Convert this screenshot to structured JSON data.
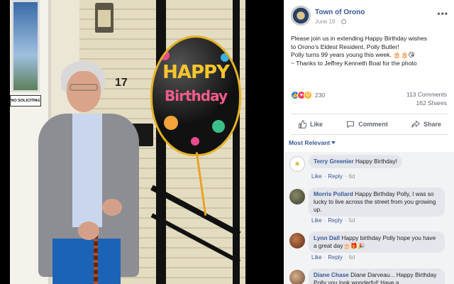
{
  "post": {
    "page_name": "Town of Orono",
    "date": "June 19",
    "dot": "·",
    "more": "•••",
    "text_lines": [
      "Please join us in extending Happy Birthday wishes",
      "to Orono's Eldest Resident, Polly Butler!",
      "Polly turns 99 years young this week. 🎂🎂😘",
      "~ Thanks to Jeffrey Kenneth Boal for the photo"
    ]
  },
  "photo": {
    "sign": "NO SOLICITING",
    "house_number": "17",
    "balloon_line1": "HAPPY",
    "balloon_line2": "Birthday"
  },
  "stats": {
    "reaction_count": "230",
    "comments": "113 Comments",
    "shares": "162 Shares"
  },
  "actions": {
    "like": "Like",
    "comment": "Comment",
    "share": "Share"
  },
  "filter": {
    "label": "Most Relevant"
  },
  "comments": [
    {
      "name": "Terry Greenier",
      "text": "Happy Birthday!",
      "like": "Like",
      "reply": "Reply",
      "time": "6d",
      "sep": "·"
    },
    {
      "name": "Morris Pollard",
      "text": "Happy Birthday Polly, I was so lucky to live across the street from you growing up.",
      "like": "Like",
      "reply": "Reply",
      "time": "5d",
      "sep": "·"
    },
    {
      "name": "Lynn Dall",
      "text": "Happy birthday Polly hope you have a great day🎂🎁🎉",
      "like": "Like",
      "reply": "Reply",
      "time": "6d",
      "sep": "·"
    },
    {
      "name": "Diane Chase",
      "text": "Diane Darveau... Happy Birthday Polly you look wonderful! Have a",
      "like": "",
      "reply": "",
      "time": "",
      "sep": ""
    }
  ],
  "colors": {
    "link": "#385898",
    "like_reaction": "#2078f4",
    "love_reaction": "#f33e58",
    "wow_reaction": "#f7b125"
  }
}
